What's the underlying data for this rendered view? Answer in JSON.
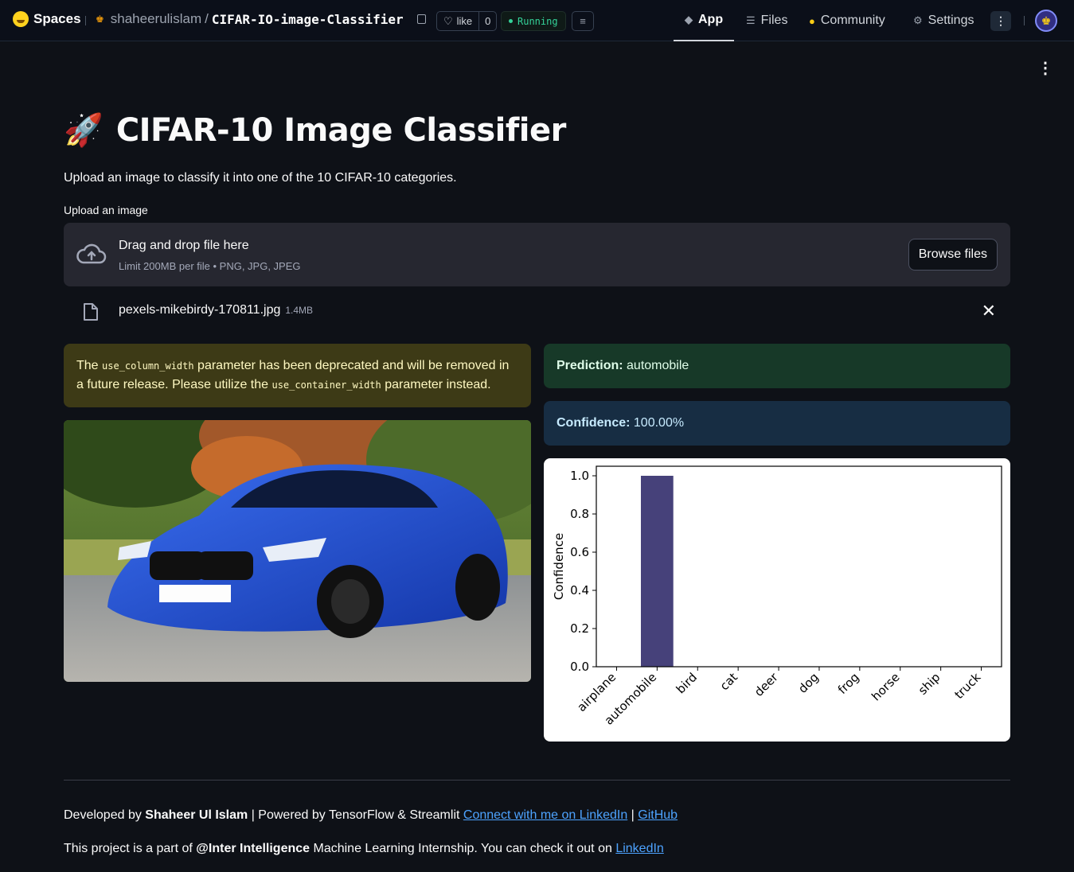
{
  "topbar": {
    "spaces_label": "Spaces",
    "owner": "shaheerulislam",
    "slash": "/",
    "repo_name": "CIFAR-IO-image-Classifier",
    "like_label": "like",
    "like_count": "0",
    "status": "Running",
    "tabs": [
      {
        "label": "App",
        "icon": "cube-icon",
        "active": true
      },
      {
        "label": "Files",
        "icon": "files-icon",
        "active": false
      },
      {
        "label": "Community",
        "icon": "community-icon",
        "active": false
      },
      {
        "label": "Settings",
        "icon": "gear-icon",
        "active": false
      }
    ]
  },
  "main": {
    "title_emoji": "🚀",
    "title": "CIFAR-10 Image Classifier",
    "subtitle": "Upload an image to classify it into one of the 10 CIFAR-10 categories.",
    "upload": {
      "label": "Upload an image",
      "drag_text": "Drag and drop file here",
      "limit_text": "Limit 200MB per file • PNG, JPG, JPEG",
      "browse_label": "Browse files"
    },
    "file": {
      "name": "pexels-mikebirdy-170811.jpg",
      "size": "1.4MB"
    },
    "warning": {
      "part1": "The ",
      "code1": "use_column_width",
      "part2": " parameter has been deprecated and will be removed in a future release. Please utilize the ",
      "code2": "use_container_width",
      "part3": " parameter instead."
    },
    "prediction": {
      "label": "Prediction:",
      "value": "automobile"
    },
    "confidence": {
      "label": "Confidence:",
      "value": "100.00%"
    }
  },
  "chart_data": {
    "type": "bar",
    "categories": [
      "airplane",
      "automobile",
      "bird",
      "cat",
      "deer",
      "dog",
      "frog",
      "horse",
      "ship",
      "truck"
    ],
    "values": [
      0.0,
      1.0,
      0.0,
      0.0,
      0.0,
      0.0,
      0.0,
      0.0,
      0.0,
      0.0
    ],
    "xlabel": "",
    "ylabel": "Confidence",
    "ylim": [
      0,
      1.05
    ],
    "yticks": [
      "0.0",
      "0.2",
      "0.4",
      "0.6",
      "0.8",
      "1.0"
    ],
    "bar_color": "#46417a",
    "grid": false
  },
  "footer": {
    "line1_prefix": "Developed by ",
    "author": "Shaheer Ul Islam",
    "line1_mid": " | Powered by TensorFlow & Streamlit ",
    "linkedin_link": "Connect with me on LinkedIn",
    "pipe": " | ",
    "github_link": "GitHub",
    "line2_prefix": "This project is a part of ",
    "org": "@Inter Intelligence",
    "line2_mid": " Machine Learning Internship. You can check it out on ",
    "line2_link": "LinkedIn"
  }
}
